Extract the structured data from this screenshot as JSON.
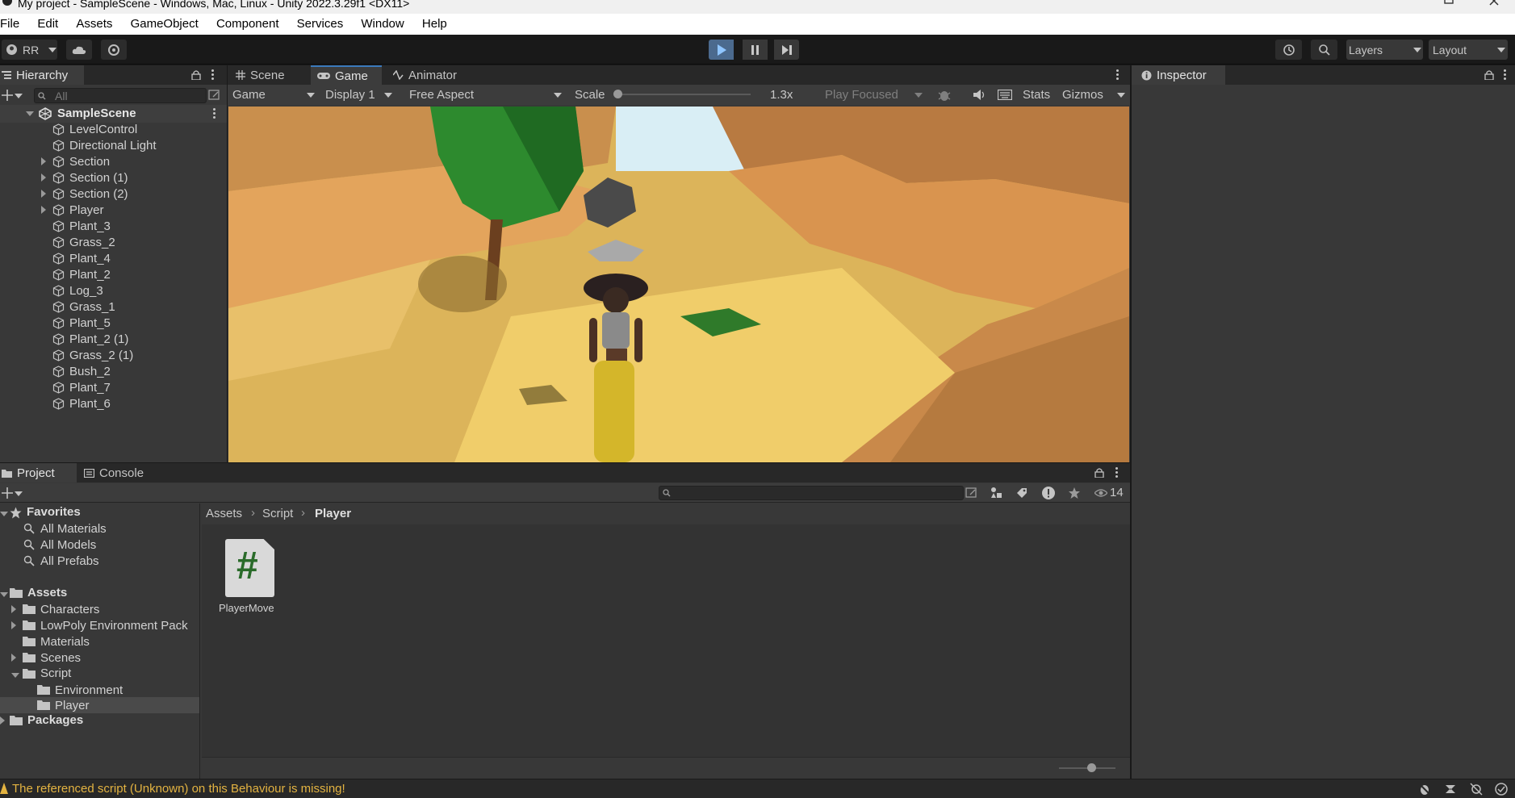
{
  "window": {
    "title": "My project - SampleScene - Windows, Mac, Linux - Unity 2022.3.29f1 <DX11>"
  },
  "menu": [
    "File",
    "Edit",
    "Assets",
    "GameObject",
    "Component",
    "Services",
    "Window",
    "Help"
  ],
  "toolbar": {
    "account": "RR",
    "layers": "Layers",
    "layout": "Layout"
  },
  "hierarchy": {
    "tab": "Hierarchy",
    "search_placeholder": "All",
    "scene": "SampleScene",
    "items": [
      {
        "label": "LevelControl",
        "expandable": false
      },
      {
        "label": "Directional Light",
        "expandable": false
      },
      {
        "label": "Section",
        "expandable": true
      },
      {
        "label": "Section (1)",
        "expandable": true
      },
      {
        "label": "Section (2)",
        "expandable": true
      },
      {
        "label": "Player",
        "expandable": true
      },
      {
        "label": "Plant_3",
        "expandable": false
      },
      {
        "label": "Grass_2",
        "expandable": false
      },
      {
        "label": "Plant_4",
        "expandable": false
      },
      {
        "label": "Plant_2",
        "expandable": false
      },
      {
        "label": "Log_3",
        "expandable": false
      },
      {
        "label": "Grass_1",
        "expandable": false
      },
      {
        "label": "Plant_5",
        "expandable": false
      },
      {
        "label": "Plant_2 (1)",
        "expandable": false
      },
      {
        "label": "Grass_2 (1)",
        "expandable": false
      },
      {
        "label": "Bush_2",
        "expandable": false
      },
      {
        "label": "Plant_7",
        "expandable": false
      },
      {
        "label": "Plant_6",
        "expandable": false
      }
    ]
  },
  "center_tabs": [
    "Scene",
    "Game",
    "Animator"
  ],
  "game_bar": {
    "mode": "Game",
    "display": "Display 1",
    "aspect": "Free Aspect",
    "scale_label": "Scale",
    "scale_value": "1.3x",
    "play_mode": "Play Focused",
    "stats": "Stats",
    "gizmos": "Gizmos"
  },
  "inspector": {
    "tab": "Inspector"
  },
  "bottom_tabs": [
    "Project",
    "Console"
  ],
  "project": {
    "hidden_count": "14",
    "favorites_label": "Favorites",
    "favorites": [
      "All Materials",
      "All Models",
      "All Prefabs"
    ],
    "assets_label": "Assets",
    "assets": [
      {
        "label": "Characters",
        "expandable": true
      },
      {
        "label": "LowPoly Environment Pack",
        "expandable": true
      },
      {
        "label": "Materials",
        "expandable": false
      },
      {
        "label": "Scenes",
        "expandable": true
      }
    ],
    "script_label": "Script",
    "script_children": [
      "Environment",
      "Player"
    ],
    "packages_label": "Packages",
    "breadcrumb": [
      "Assets",
      "Script",
      "Player"
    ],
    "files": [
      {
        "name": "PlayerMove",
        "glyph": "#"
      }
    ]
  },
  "status": {
    "message": "The referenced script (Unknown) on this Behaviour is missing!"
  },
  "colors": {
    "accent": "#3a79bb",
    "warning": "#e3b341",
    "panel": "#383838",
    "dark": "#191919"
  }
}
